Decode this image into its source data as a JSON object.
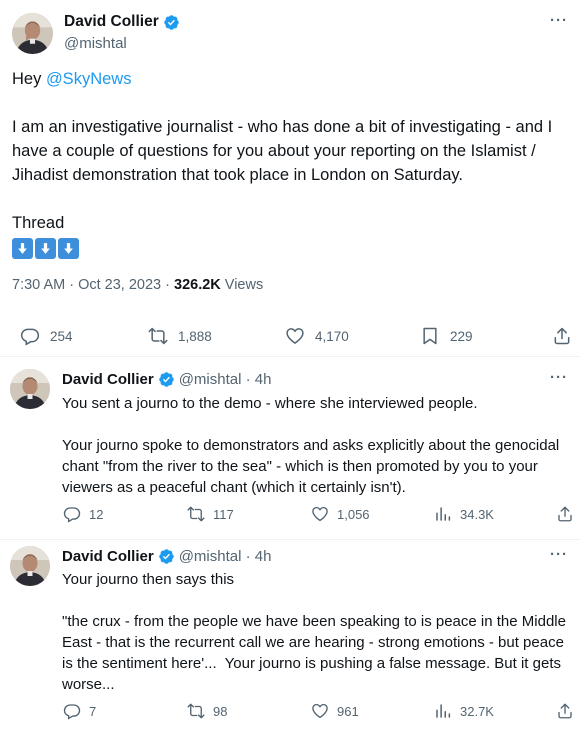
{
  "main_tweet": {
    "author_name": "David Collier",
    "author_handle": "@mishtal",
    "greeting": "Hey ",
    "mention": "@SkyNews",
    "body": "I am an investigative journalist - who has done a bit of investigating - and I have a couple of questions for you about your reporting on the Islamist / Jihadist demonstration that took place in London on Saturday.",
    "thread_label": "Thread",
    "arrow_emoji_count": 3,
    "time": "7:30 AM · Oct 23, 2023 · ",
    "views_count": "326.2K",
    "views_label": " Views",
    "stats": {
      "replies": "254",
      "retweets": "1,888",
      "likes": "4,170",
      "bookmarks": "229"
    }
  },
  "replies": [
    {
      "author_name": "David Collier",
      "handle_time": "@mishtal · 4h",
      "text": "You sent a journo to the demo - where she interviewed people.\n\nYour journo spoke to demonstrators and asks explicitly about the genocidal chant \"from the river to the sea\" - which is then promoted by you to your viewers as a peaceful chant (which it certainly isn't).",
      "stats": {
        "replies": "12",
        "retweets": "117",
        "likes": "1,056",
        "views": "34.3K"
      }
    },
    {
      "author_name": "David Collier",
      "handle_time": "@mishtal · 4h",
      "text": "Your journo then says this\n\n\"the crux - from the people we have been speaking to is peace in the Middle East - that is the recurrent call we are hearing - strong emotions - but peace is the sentiment here'...  Your journo is pushing a false message. But it gets worse...",
      "stats": {
        "replies": "7",
        "retweets": "98",
        "likes": "961",
        "views": "32.7K"
      }
    }
  ],
  "icons": {
    "reply": "reply-icon",
    "retweet": "retweet-icon",
    "like": "heart-icon",
    "bookmark": "bookmark-icon",
    "share": "share-icon",
    "views": "views-icon",
    "more": "more-icon",
    "verified": "verified-badge-icon"
  },
  "colors": {
    "accent": "#1d9bf0",
    "secondary_text": "#536471",
    "primary_text": "#0f1419",
    "divider": "#eff3f4",
    "emoji_blue": "#3d8fdc"
  }
}
